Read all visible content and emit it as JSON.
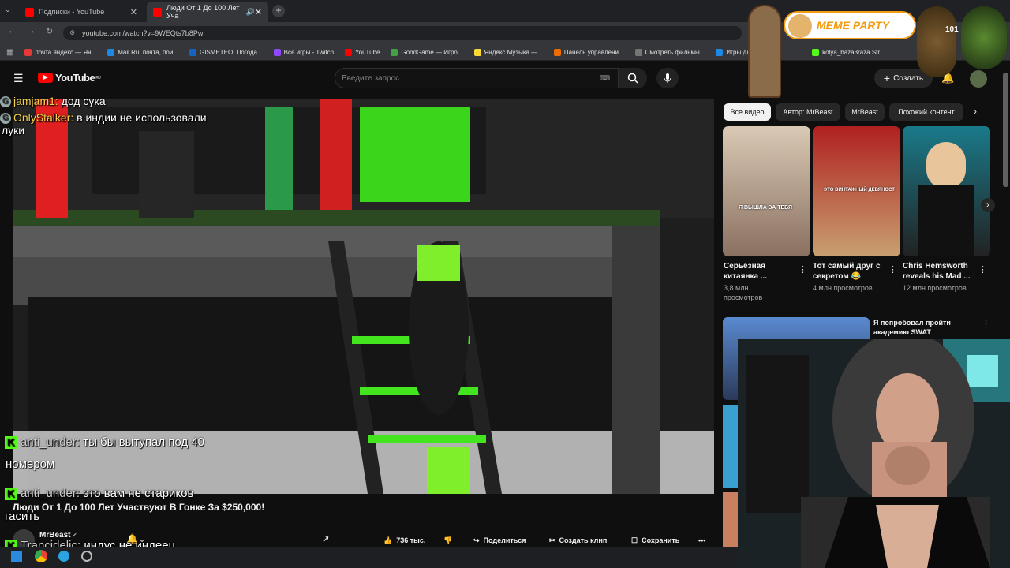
{
  "browser": {
    "tabs": [
      {
        "title": "Подписки - YouTube"
      },
      {
        "title": "Люди От 1 До 100 Лет Уча"
      }
    ],
    "url": "youtube.com/watch?v=9WEQts7b8Pw",
    "bookmarks": [
      {
        "label": "почта яндекс — Ян...",
        "color": "#e53935"
      },
      {
        "label": "Mail.Ru: почта, пои...",
        "color": "#1e88e5"
      },
      {
        "label": "GISMETEO: Погода...",
        "color": "#1565c0"
      },
      {
        "label": "Все игры - Twitch",
        "color": "#9146ff"
      },
      {
        "label": "YouTube",
        "color": "#ff0000"
      },
      {
        "label": "GoodGame — Игро...",
        "color": "#43a047"
      },
      {
        "label": "Яндекс Музыка —...",
        "color": "#fdd835"
      },
      {
        "label": "Панель управлени...",
        "color": "#ef6c00"
      },
      {
        "label": "Смотреть фильмы...",
        "color": "#757575"
      },
      {
        "label": "Игры для",
        "color": "#1e88e5"
      },
      {
        "label": "kolya_baza3raza Str...",
        "color": "#53fc18"
      }
    ]
  },
  "youtube": {
    "logo_text": "YouTube",
    "region": "RU",
    "search_placeholder": "Введите запрос",
    "create_label": "Создать"
  },
  "video": {
    "title": "Люди От 1 До 100 Лет Участвуют В Гонке За $250,000!",
    "channel": "MrBeast",
    "likes": "736 тыс.",
    "share": "Поделиться",
    "clip": "Создать клип",
    "save": "Сохранить"
  },
  "chat": [
    {
      "platform": "goodgame",
      "user": "jamjam1:",
      "text": "дод сука"
    },
    {
      "platform": "goodgame",
      "user": "OnlyStalker:",
      "text": "в индии не использовали",
      "cont": "луки"
    },
    {
      "platform": "kick",
      "user": "anti_under:",
      "text": "ты бы вытупал под 40",
      "cont": "номером"
    },
    {
      "platform": "kick",
      "user": "anti_under:",
      "text": "это вам не стариков",
      "cont": "гасить"
    },
    {
      "platform": "kick",
      "user": "Trancidelic:",
      "text": "индус не индеец"
    }
  ],
  "chips": [
    "Все видео",
    "Автор: MrBeast",
    "MrBeast",
    "Похожий контент"
  ],
  "recommendations": [
    {
      "title1": "Серьёзная",
      "title2": "китаянка ...",
      "meta1": "3,8 млн",
      "meta2": "просмотров",
      "caption": "Я ВЫШЛА ЗА ТЕБЯ"
    },
    {
      "title1": "Тот самый друг с",
      "title2": "секретом 😂",
      "meta1": "4 млн просмотров",
      "meta2": "",
      "caption": "ЭТО ВИНТАЖНЫЙ ДЕВЯНОСТ"
    },
    {
      "title1": "Chris Hemsworth",
      "title2": "reveals his Mad ...",
      "meta1": "12 млн просмотров",
      "meta2": "",
      "caption": ""
    }
  ],
  "list_item": {
    "title1": "Я попробовал пройти",
    "title2": "академию SWAT"
  },
  "overlay": {
    "brand": "MEME PARTY",
    "counter": "101"
  }
}
